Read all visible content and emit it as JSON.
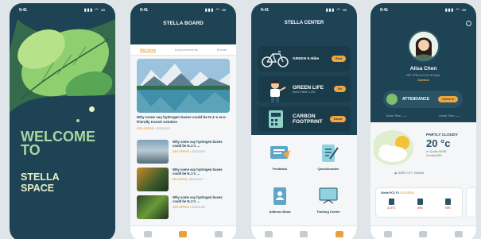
{
  "status_time": "9:41",
  "status_signal": "▮▮▮ ◠ ▭",
  "welcome": {
    "line1": "WELCOME",
    "line2": "TO",
    "line3": "STELLA",
    "line4": "SPACE"
  },
  "board": {
    "title": "STELLA BOARD",
    "tabs": [
      "ESG News",
      "Announcements",
      "Events"
    ],
    "active_tab": "ESG News",
    "hero_headline": "Why some say hydrogen buses could be N.J.'s eco-friendly transit solution",
    "hero_office": "CEO OFFICE",
    "hero_date": "• 2022/12/21",
    "news": [
      {
        "headline": "Why some say hydrogen buses could be N.J.'s ...",
        "office": "CEO OFFICE",
        "date": "• 2022/12/16"
      },
      {
        "headline": "Why some say hydrogen buses could be N.J.'s ...",
        "office": "HR OFFICE",
        "date": "• 2022/12/12"
      },
      {
        "headline": "Why some say hydrogen buses could be N.J.'s ...",
        "office": "CEO OFFICE",
        "date": "• 2022/11/28"
      }
    ]
  },
  "center": {
    "title": "STELLA CENTER",
    "cards": [
      {
        "label": "GREEN E-Bike",
        "button": "Rent"
      },
      {
        "label": "GREEN LIFE",
        "sub": "Green Points: 1,200",
        "button": "Go"
      },
      {
        "label_line1": "CARBON",
        "label_line2": "FOOTPRINT",
        "button": "Count"
      }
    ],
    "grid": [
      "Feedback",
      "Questionnaire",
      "Address Book",
      "Training Center"
    ]
  },
  "profile": {
    "name": "Alisa Chen",
    "dept": "HET STELLA PUC HR Dept.",
    "role": "Operator",
    "attendance_label": "ATTENDANCE",
    "checkin": "Check in",
    "arrive": "Arrive Time  ——",
    "leave": "Leave Time  ——",
    "weather_cond": "PARTLY CLOUDY",
    "temperature": "20 °c",
    "air_quality_label": "Air Quality",
    "air_quality": "GOOD",
    "humidity_label": "Humidity",
    "humidity": "65%",
    "location": "◉  TAIPEI CITY, TAIWAN",
    "pcc_title": "Stella PCC F1",
    "pcc_status": "(CLOSED)",
    "pcc_values": [
      "21.6°C",
      "65%",
      "65%"
    ]
  },
  "colors": {
    "navy": "#1e4354",
    "orange": "#f0a640",
    "green": "#a9d6a2"
  }
}
